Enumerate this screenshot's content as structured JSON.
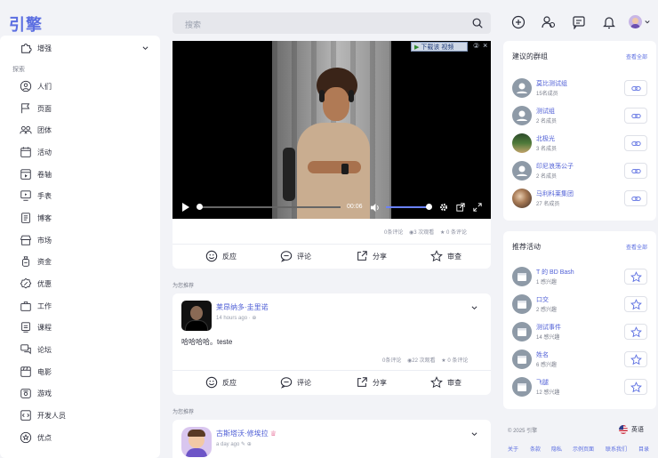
{
  "app": {
    "logo": "引擎"
  },
  "search": {
    "placeholder": "搜索"
  },
  "sidebar": {
    "top_item": "增强",
    "section_label": "探索",
    "items": [
      "人们",
      "页面",
      "团体",
      "活动",
      "卷轴",
      "手表",
      "博客",
      "市场",
      "资金",
      "优惠",
      "工作",
      "课程",
      "论坛",
      "电影",
      "游戏",
      "开发人员",
      "优点"
    ]
  },
  "video_post": {
    "ad_banner": "下载该 视频",
    "ad_badge": "②",
    "ad_close": "×",
    "time": "00:06",
    "stats": {
      "reactions": "0条评论",
      "views": "3 次观看",
      "comments": "0 条评论"
    },
    "actions": [
      "反应",
      "评论",
      "分享",
      "审查"
    ]
  },
  "label_recommended": "为您推荐",
  "post2": {
    "author": "莱昂纳多·圭里诺",
    "time": "14 hours ago",
    "text": "哈哈哈哈。teste",
    "stats": {
      "reactions": "0条评论",
      "views": "22 次观看",
      "comments": "0 条评论"
    },
    "actions": [
      "反应",
      "评论",
      "分享",
      "审查"
    ]
  },
  "label_recommended2": "为您推荐",
  "post3": {
    "author": "古斯塔沃·修埃拉",
    "time": "a day ago"
  },
  "groups": {
    "title": "建议的群组",
    "see_all": "查看全部",
    "items": [
      {
        "name": "莫比测试组",
        "members": "15名成员"
      },
      {
        "name": "测试组",
        "members": "2 名成员"
      },
      {
        "name": "北极光",
        "members": "3 名成员"
      },
      {
        "name": "印尼浪荡公子",
        "members": "2 名成员"
      },
      {
        "name": "马利科莱集团",
        "members": "27 名成员"
      }
    ]
  },
  "events": {
    "title": "推荐活动",
    "see_all": "查看全部",
    "items": [
      {
        "name": "T 的 BD Bash",
        "sub": "1 感兴趣"
      },
      {
        "name": "口交",
        "sub": "2 感兴趣"
      },
      {
        "name": "测试事件",
        "sub": "14 感兴趣"
      },
      {
        "name": "姓名",
        "sub": "6 感兴趣"
      },
      {
        "name": "飞腿",
        "sub": "12 感兴趣"
      }
    ]
  },
  "footer": {
    "copyright": "© 2025 引擎",
    "language": "英语",
    "links": [
      "关于",
      "条款",
      "隐私",
      "示例页面",
      "联系我们",
      "目录"
    ]
  },
  "colors": {
    "accent": "#5b6ee1",
    "background": "#f2f3f7"
  }
}
